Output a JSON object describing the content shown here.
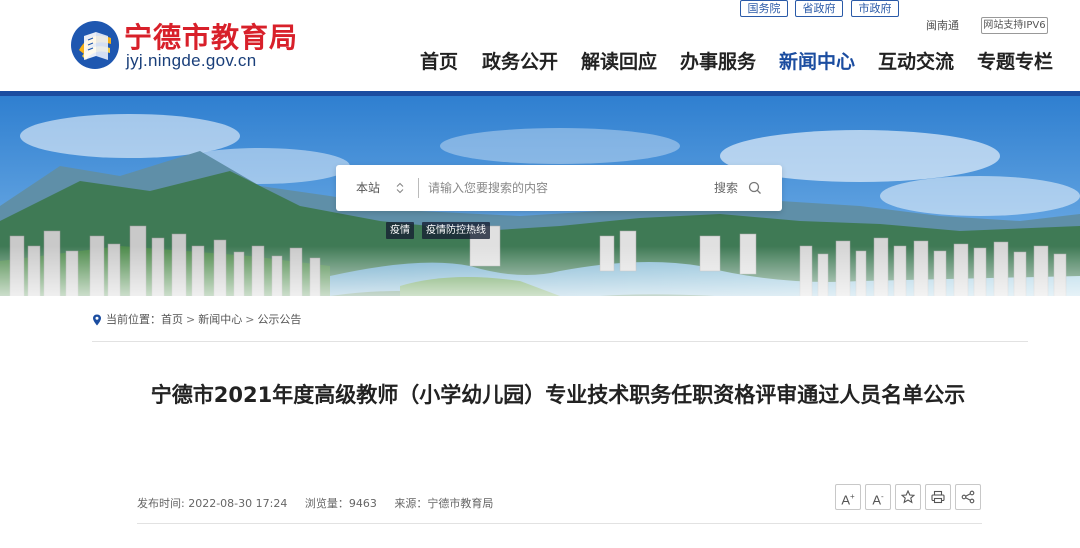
{
  "site": {
    "title": "宁德市教育局",
    "domain": "jyj.ningde.gov.cn"
  },
  "toplinks": [
    {
      "label": "国务院"
    },
    {
      "label": "省政府"
    },
    {
      "label": "市政府"
    }
  ],
  "toptext": {
    "dialect": "闽南通",
    "ipv6": "网站支持IPV6"
  },
  "nav": [
    {
      "label": "首页"
    },
    {
      "label": "政务公开"
    },
    {
      "label": "解读回应"
    },
    {
      "label": "办事服务"
    },
    {
      "label": "新闻中心",
      "active": true
    },
    {
      "label": "互动交流"
    },
    {
      "label": "专题专栏"
    }
  ],
  "search": {
    "scope": "本站",
    "placeholder": "请输入您要搜索的内容",
    "button": "搜索"
  },
  "hot_tags": [
    "疫情",
    "疫情防控热线"
  ],
  "breadcrumb": {
    "prefix": "当前位置：",
    "items": [
      "首页",
      "新闻中心",
      "公示公告"
    ],
    "separator": ">"
  },
  "article": {
    "title": "宁德市2021年度高级教师（小学幼儿园）专业技术职务任职资格评审通过人员名单公示",
    "published": "发布时间: 2022-08-30 17:24",
    "views": "浏览量：9463",
    "source": "来源：宁德市教育局"
  },
  "tools": {
    "font_larger": "A",
    "font_larger_sign": "+",
    "font_smaller": "A",
    "font_smaller_sign": "-"
  },
  "colors": {
    "brand_red": "#d8202a",
    "brand_blue": "#1b4da0",
    "nav_active": "#1b4da0"
  }
}
